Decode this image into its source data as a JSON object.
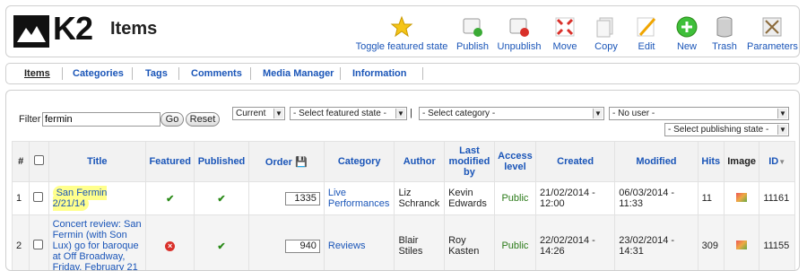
{
  "header": {
    "logo_text": "K2",
    "title": "Items",
    "toolbar": [
      {
        "label": "Toggle featured state",
        "icon": "star-icon"
      },
      {
        "label": "Publish",
        "icon": "publish-icon"
      },
      {
        "label": "Unpublish",
        "icon": "unpublish-icon"
      },
      {
        "label": "Move",
        "icon": "move-icon"
      },
      {
        "label": "Copy",
        "icon": "copy-icon"
      },
      {
        "label": "Edit",
        "icon": "edit-icon"
      },
      {
        "label": "New",
        "icon": "new-icon"
      },
      {
        "label": "Trash",
        "icon": "trash-icon"
      },
      {
        "label": "Parameters",
        "icon": "parameters-icon"
      }
    ]
  },
  "subnav": [
    "Items",
    "Categories",
    "Tags",
    "Comments",
    "Media Manager",
    "Information"
  ],
  "filters": {
    "filter_label": "Filter",
    "filter_value": "fermin",
    "go_label": "Go",
    "reset_label": "Reset",
    "current": "Current",
    "featured": "- Select featured state -",
    "sep": "|",
    "category": "- Select category -",
    "user": "- No user -",
    "publishing": "- Select publishing state -"
  },
  "table": {
    "headers": {
      "num": "#",
      "title": "Title",
      "featured": "Featured",
      "published": "Published",
      "order": "Order",
      "category": "Category",
      "author": "Author",
      "last_modified": "Last modified by",
      "access": "Access level",
      "created": "Created",
      "modified": "Modified",
      "hits": "Hits",
      "image": "Image",
      "id": "ID"
    },
    "rows": [
      {
        "num": "1",
        "title": "San Fermin 2/21/14",
        "featured": "yes",
        "published": "yes",
        "order": "1335",
        "category": "Live Performances",
        "author": "Liz Schranck",
        "modified_by": "Kevin Edwards",
        "access": "Public",
        "created": "21/02/2014 - 12:00",
        "modified": "06/03/2014 - 11:33",
        "hits": "11",
        "id": "11161"
      },
      {
        "num": "2",
        "title": "Concert review: San Fermin (with Son Lux) go for baroque at Off Broadway, Friday, February 21",
        "featured": "no",
        "published": "yes",
        "order": "940",
        "category": "Reviews",
        "author": "Blair Stiles",
        "modified_by": "Roy Kasten",
        "access": "Public",
        "created": "22/02/2014 - 14:26",
        "modified": "23/02/2014 - 14:31",
        "hits": "309",
        "id": "11155"
      }
    ]
  }
}
